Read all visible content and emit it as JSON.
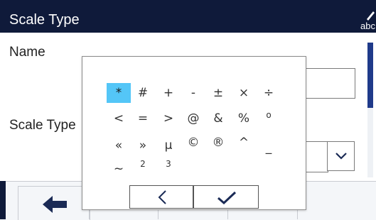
{
  "header": {
    "title": "Scale Type",
    "keyboard_toggle_label": "abc"
  },
  "form": {
    "name_label": "Name",
    "scale_type_label": "Scale Type",
    "name_value": "",
    "scale_type_value": ""
  },
  "symbol_picker": {
    "selected": "*",
    "rows": [
      [
        "*",
        "#",
        "+",
        "-",
        "±",
        "×",
        "÷"
      ],
      [
        "<",
        "=",
        ">",
        "@",
        "&",
        "%",
        "º"
      ],
      [
        "«",
        "»",
        "µ",
        "©",
        "®",
        "^",
        "_"
      ],
      [
        "~",
        "²",
        "³"
      ]
    ],
    "display_rows": [
      [
        "*",
        "#",
        "+",
        "-",
        "±",
        "×",
        "÷"
      ],
      [
        "<",
        "=",
        ">",
        "@",
        "&",
        "%",
        "o"
      ],
      [
        "«",
        "»",
        "µ",
        "©",
        "®",
        "^",
        "_"
      ],
      [
        "~",
        "2",
        "3"
      ]
    ],
    "back_icon": "chevron-left-icon",
    "confirm_icon": "checkmark-icon"
  },
  "icons": {
    "keyboard": "pencil-abc-icon",
    "dropdown": "chevron-down-icon",
    "footer_back": "arrow-left-icon"
  },
  "colors": {
    "header_bg": "#0f1a3a",
    "selection": "#54c6f7",
    "scrollbar_thumb": "#1f3a8a"
  }
}
